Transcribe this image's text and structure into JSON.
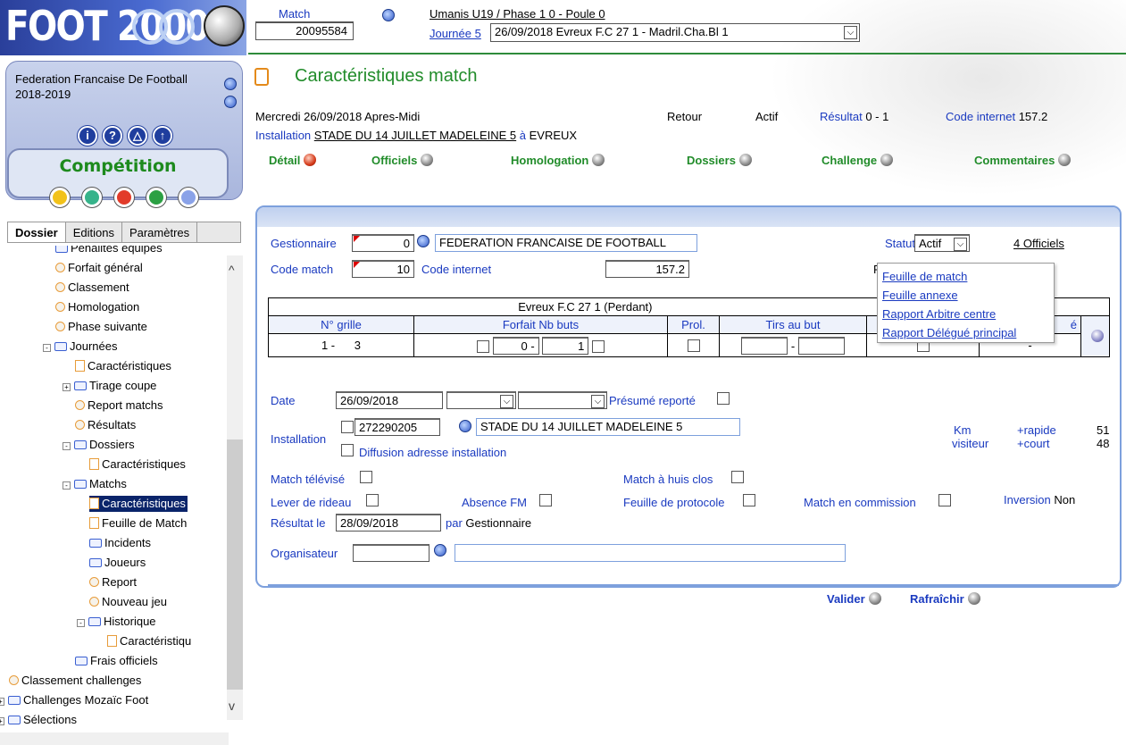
{
  "logo": {
    "text": "FOOT 2000"
  },
  "sidebar": {
    "federation": "Federation Francaise De Football",
    "season": "2018-2019",
    "nav_buttons": [
      "i",
      "?",
      "△",
      "↑"
    ],
    "section_title": "Compétition",
    "color_dots": [
      "#f2c21a",
      "#36b38a",
      "#e23b2a",
      "#2ba043",
      "#8aa2e8"
    ],
    "tabs": [
      "Dossier",
      "Editions",
      "Paramètres"
    ],
    "tree": [
      {
        "label": "Pénalités équipes",
        "icon": "folder",
        "depth": 1
      },
      {
        "label": "Forfait général",
        "icon": "clock",
        "depth": 1
      },
      {
        "label": "Classement",
        "icon": "clock",
        "depth": 1
      },
      {
        "label": "Homologation",
        "icon": "clock",
        "depth": 1
      },
      {
        "label": "Phase suivante",
        "icon": "clock",
        "depth": 1
      },
      {
        "label": "Journées",
        "icon": "folder",
        "depth": 1,
        "expander": "-"
      },
      {
        "label": "Caractéristiques",
        "icon": "page",
        "depth": 2
      },
      {
        "label": "Tirage coupe",
        "icon": "folder",
        "depth": 2,
        "expander": "+"
      },
      {
        "label": "Report matchs",
        "icon": "clock",
        "depth": 2
      },
      {
        "label": "Résultats",
        "icon": "clock",
        "depth": 2
      },
      {
        "label": "Dossiers",
        "icon": "folder",
        "depth": 2,
        "expander": "-"
      },
      {
        "label": "Caractéristiques",
        "icon": "page",
        "depth": 3
      },
      {
        "label": "Matchs",
        "icon": "folder",
        "depth": 2,
        "expander": "-"
      },
      {
        "label": "Caractéristiques",
        "icon": "page",
        "depth": 3,
        "selected": true
      },
      {
        "label": "Feuille de Match",
        "icon": "page",
        "depth": 3
      },
      {
        "label": "Incidents",
        "icon": "folder",
        "depth": 3
      },
      {
        "label": "Joueurs",
        "icon": "folder",
        "depth": 3
      },
      {
        "label": "Report",
        "icon": "clock",
        "depth": 3
      },
      {
        "label": "Nouveau jeu",
        "icon": "clock",
        "depth": 3
      },
      {
        "label": "Historique",
        "icon": "folder",
        "depth": 3,
        "expander": "-"
      },
      {
        "label": "Caractéristiqu",
        "icon": "page",
        "depth": 4
      },
      {
        "label": "Frais officiels",
        "icon": "folder",
        "depth": 2
      },
      {
        "label": "Classement challenges",
        "icon": "clock",
        "depth": 0
      },
      {
        "label": "Challenges Mozaïc Foot",
        "icon": "folder",
        "depth": 0,
        "expander": "+"
      },
      {
        "label": "Sélections",
        "icon": "folder",
        "depth": 0,
        "expander": "+"
      }
    ]
  },
  "header": {
    "match_label": "Match",
    "match_number": "20095584",
    "competition": "Umanis U19 / Phase 1  0 - Poule 0",
    "journee_label": "Journée 5",
    "journee_select": "26/09/2018 Evreux F.C 27 1 - Madril.Cha.Bl 1",
    "page_title": "Caractéristiques match"
  },
  "summary": {
    "datetime": "Mercredi 26/09/2018 Apres-Midi",
    "retour": "Retour",
    "actif": "Actif",
    "resultat_label": "Résultat",
    "resultat_value": "0 - 1",
    "code_internet_label": "Code internet",
    "code_internet_value": "157.2",
    "installation_label": "Installation",
    "installation_name": "STADE DU 14 JUILLET MADELEINE 5",
    "a": "à",
    "city": "EVREUX"
  },
  "subtabs": [
    {
      "label": "Détail",
      "dot": "red"
    },
    {
      "label": "Officiels",
      "dot": "grey"
    },
    {
      "label": "Homologation",
      "dot": "grey"
    },
    {
      "label": "Dossiers",
      "dot": "grey"
    },
    {
      "label": "Challenge",
      "dot": "grey"
    },
    {
      "label": "Commentaires",
      "dot": "grey"
    }
  ],
  "form": {
    "gestionnaire_label": "Gestionnaire",
    "gestionnaire_code": "0",
    "gestionnaire_name": "FEDERATION FRANCAISE DE FOOTBALL",
    "statut_label": "Statut",
    "statut_value": "Actif",
    "officiels_link": "4 Officiels",
    "code_match_label": "Code match",
    "code_match_value": "10",
    "code_internet_label": "Code internet",
    "code_internet_value": "157.2",
    "hidden_letter": "F",
    "home_team": "Evreux F.C 27 1 (Perdant)",
    "away_team_partial": "Madril",
    "score_headers": [
      "N° grille",
      "Forfait Nb buts",
      "Prol.",
      "Tirs au but",
      "",
      "é"
    ],
    "grille_prefix": "1 -",
    "grille_value": "3",
    "score_home": "0",
    "score_sep": "-",
    "score_away": "1",
    "tab_sep": "-",
    "away_dash": "-",
    "date_label": "Date",
    "date_value": "26/09/2018",
    "presume_reporte": "Présumé reporté",
    "installation_label": "Installation",
    "installation_code": "272290205",
    "installation_name": "STADE DU 14 JUILLET MADELEINE 5",
    "diffusion_label": "Diffusion adresse installation",
    "km_label": "Km",
    "visiteur_label": "visiteur",
    "rapide_label": "+rapide",
    "court_label": "+court",
    "rapide_value": "51",
    "court_value": "48",
    "match_televise": "Match télévisé",
    "huis_clos": "Match à huis clos",
    "lever_rideau": "Lever de rideau",
    "absence_fm": "Absence FM",
    "feuille_protocole": "Feuille de protocole",
    "match_commission": "Match en commission",
    "inversion_label": "Inversion",
    "inversion_value": "Non",
    "resultat_le_label": "Résultat le",
    "resultat_le_value": "28/09/2018",
    "par_label": "par",
    "par_value": "Gestionnaire",
    "organisateur_label": "Organisateur",
    "organisateur_code": "",
    "organisateur_name": ""
  },
  "popup_menu": [
    "Feuille de match",
    "Feuille annexe",
    "Rapport Arbitre centre",
    "Rapport Délégué principal"
  ],
  "actions": {
    "valider": "Valider",
    "rafraichir": "Rafraîchir"
  }
}
